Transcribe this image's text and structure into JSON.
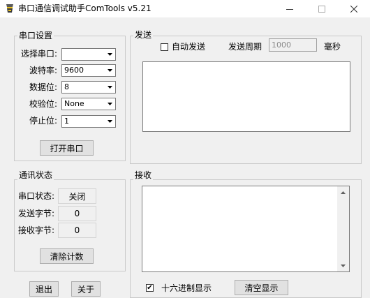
{
  "window": {
    "title": "串口通信调试助手ComTools v5.21"
  },
  "serial_settings": {
    "group_title": "串口设置",
    "port_label": "选择串口:",
    "port_value": "",
    "baud_label": "波特率:",
    "baud_value": "9600",
    "databits_label": "数据位:",
    "databits_value": "8",
    "parity_label": "校验位:",
    "parity_value": "None",
    "stopbits_label": "停止位:",
    "stopbits_value": "1",
    "open_button": "打开串口"
  },
  "comm_status": {
    "group_title": "通讯状态",
    "port_status_label": "串口状态:",
    "port_status_value": "关闭",
    "sent_bytes_label": "发送字节:",
    "sent_bytes_value": "0",
    "recv_bytes_label": "接收字节:",
    "recv_bytes_value": "0",
    "clear_count_button": "清除计数"
  },
  "send": {
    "group_title": "发送",
    "auto_send_label": "自动发送",
    "auto_send_checked": false,
    "period_label": "发送周期",
    "period_value": "1000",
    "period_unit": "毫秒"
  },
  "receive": {
    "group_title": "接收",
    "hex_display_label": "十六进制显示",
    "hex_display_checked": true,
    "clear_display_button": "清空显示"
  },
  "footer": {
    "exit_button": "退出",
    "about_button": "关于"
  }
}
